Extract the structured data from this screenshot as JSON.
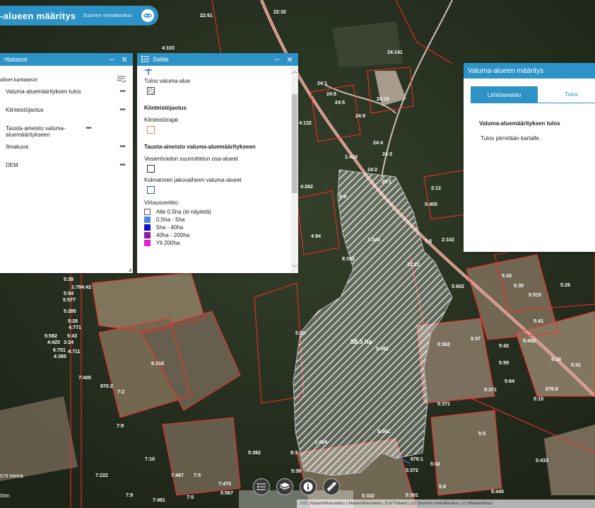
{
  "app": {
    "title": "-alueen määritys",
    "subtitle": "Suomen metsäkeskus"
  },
  "layers_panel": {
    "title": "rttatasot",
    "list_heading": "alliset karttatasot",
    "items": [
      {
        "label": "Valuma-aluemäärityksen tulos"
      },
      {
        "label": "Kiinteistöjaotus"
      },
      {
        "label": "Tausta-aineisto valuma-aluemääritykseen"
      },
      {
        "label": "Ilmakuva"
      },
      {
        "label": "DEM"
      }
    ]
  },
  "legend_panel": {
    "title": "Selite",
    "sections": {
      "result_item": "Tulos valuma-alue",
      "property_title": "Kiinteistöjaotus",
      "property_item": "Kiinteistörajat",
      "background_title": "Tausta-aineisto valuma-aluemääritykseen",
      "subareas_item": "Vesienhoidon suunnittelun osa-alueet",
      "third_level_item": "Kolmannen jakovaiheen valuma-alueet",
      "network_title": "Virtausverkko",
      "network_items": [
        {
          "label": "Alle 0.5ha (ei näytetä)",
          "color": "#ffffff"
        },
        {
          "label": "0,5ha - 5ha",
          "color": "#4a86e0"
        },
        {
          "label": "5ha - 40ha",
          "color": "#1010cc"
        },
        {
          "label": "40ha - 200ha",
          "color": "#8a1aa8"
        },
        {
          "label": "Yli 200ha",
          "color": "#e020d0"
        }
      ]
    }
  },
  "delineation_panel": {
    "title": "Valuma-alueen määritys",
    "tab_source": "Lähtöaineisto",
    "tab_result": "Tulos",
    "result_heading": "Valuma-aluemäärityksen tulos",
    "result_text": "Tulos piirretään kartalle."
  },
  "map": {
    "area_label": "58.5 ha",
    "scale_label": "579 Metriä",
    "scale_value": "00m",
    "attribution": "...015 | Maanmittauslaitos | Maanmittauslaitos, Esri Finland | (c) Suomen metsäkeskus | (c) Maanmittaus"
  },
  "toolbar": {
    "icons": [
      "legend-icon",
      "layers-icon",
      "info-icon",
      "measure-icon"
    ]
  },
  "colors": {
    "accent": "#2d93c7",
    "parcel_border": "#ff2a2a"
  }
}
